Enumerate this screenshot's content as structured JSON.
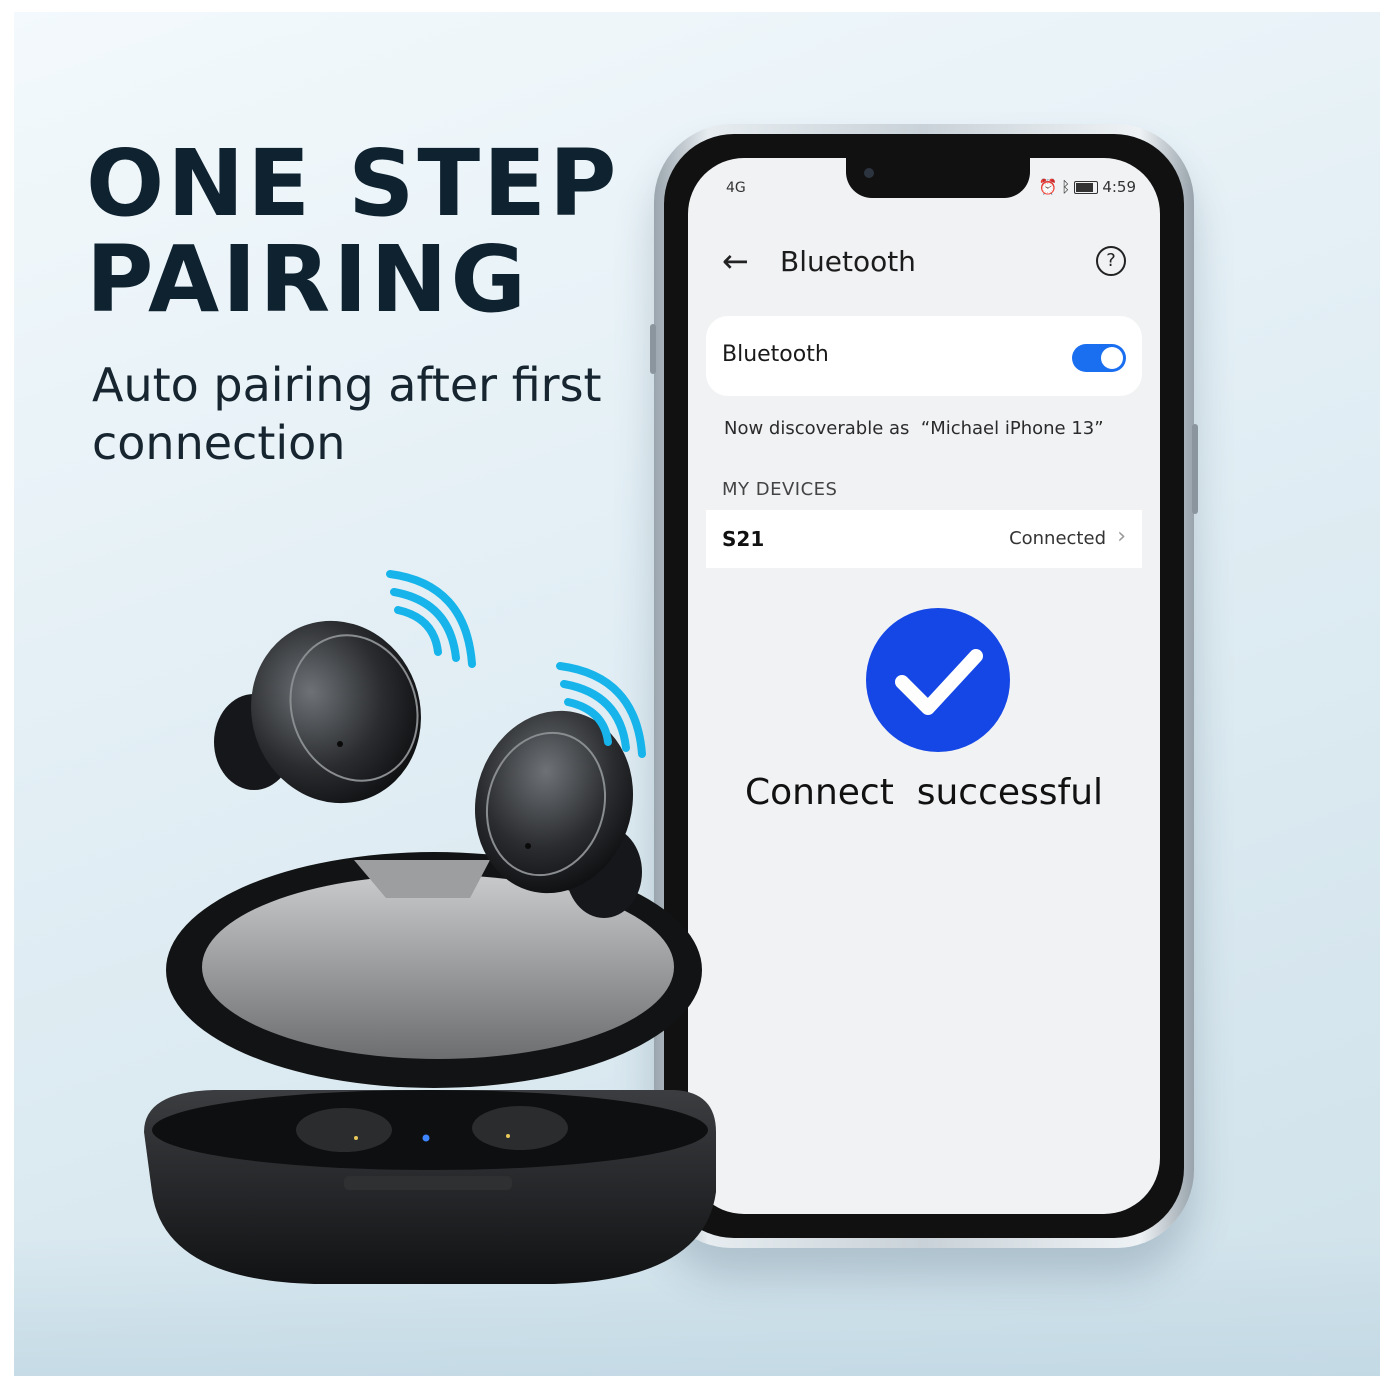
{
  "headline": [
    "ONE STEP",
    "PAIRING"
  ],
  "subline": [
    "Auto pairing after first",
    "connection"
  ],
  "phone": {
    "status_time": "4:59",
    "status_network": "4G",
    "nav_title": "Bluetooth",
    "bluetooth_label": "Bluetooth",
    "bluetooth_on": true,
    "discoverable_text": "Now discoverable as  “Michael iPhone 13”",
    "section_header": "MY DEVICES",
    "device_name": "S21",
    "device_status": "Connected",
    "success_message": "Connect  successful"
  },
  "colors": {
    "headline": "#0f2230",
    "accent_blue": "#1447e6",
    "toggle_blue": "#1a6ff0",
    "signal_cyan": "#16b4ea"
  },
  "icons": [
    "back-arrow-icon",
    "help-icon",
    "bluetooth-toggle",
    "chevron-right-icon",
    "checkmark-icon",
    "wireless-signal-icon"
  ]
}
